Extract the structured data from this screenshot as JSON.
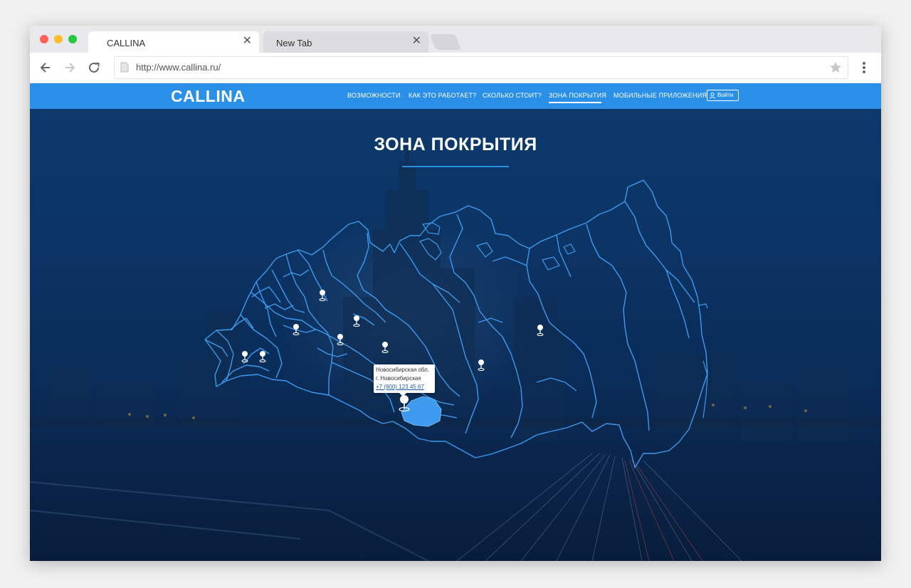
{
  "browser": {
    "tabs": [
      {
        "title": "CALLINA"
      },
      {
        "title": "New Tab"
      }
    ],
    "url": "http://www.callina.ru/",
    "traffic_lights": [
      "#ff5f57",
      "#febc2e",
      "#28c840"
    ]
  },
  "site": {
    "logo": "CALLINA",
    "nav": [
      {
        "label": "ВОЗМОЖНОСТИ"
      },
      {
        "label": "КАК ЭТО РАБОТАЕТ?"
      },
      {
        "label": "СКОЛЬКО СТОИТ?"
      },
      {
        "label": "ЗОНА ПОКРЫТИЯ",
        "active": true
      },
      {
        "label": "МОБИЛЬНЫЕ ПРИЛОЖЕНИЯ"
      }
    ],
    "login_label": "Войти",
    "accent": "#2a8fe6"
  },
  "main": {
    "heading": "ЗОНА ПОКРЫТИЯ",
    "tooltip": {
      "region": "Новосибирская обл.",
      "city": "г. Новосибирская",
      "phone": "+7 (900) 123 45 67"
    }
  }
}
